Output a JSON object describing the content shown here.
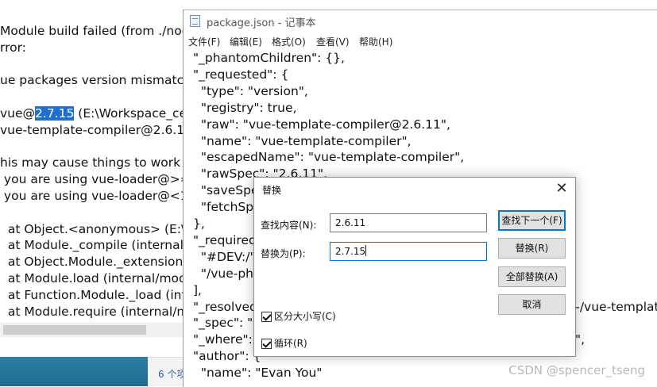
{
  "background_page": {
    "lines": [
      "Module build failed (from ./nod",
      "rror:",
      "",
      "ue packages version mismatch",
      "",
      "vue@|2.7.15| (E:\\Workspace_ce",
      "vue-template-compiler@2.6.1",
      "",
      "his may cause things to work i",
      " you are using vue-loader@>=",
      " you are using vue-loader@<1",
      "",
      "  at Object.<anonymous> (E:\\",
      "  at Module._compile (internal/",
      "  at Object.Module._extensions",
      "  at Module.load (internal/mod",
      "  at Function.Module._load (int",
      "  at Module.require (internal/m"
    ],
    "status_text": "6 个项"
  },
  "notepad": {
    "title": "package.json - 记事本",
    "menu": [
      {
        "label": "文件(F)"
      },
      {
        "label": "编辑(E)"
      },
      {
        "label": "格式(O)"
      },
      {
        "label": "查看(V)"
      },
      {
        "label": "帮助(H)"
      }
    ],
    "text_lines": [
      "\"_phantomChildren\": {},",
      "\"_requested\": {",
      "  \"type\": \"version\",",
      "  \"registry\": true,",
      "  \"raw\": \"vue-template-compiler@2.6.11\",",
      "  \"name\": \"vue-template-compiler\",",
      "  \"escapedName\": \"vue-template-compiler\",",
      "  \"rawSpec\": \"2.6.11\",",
      "  \"saveSpe",
      "  \"fetchSp",
      "},",
      "\"_required",
      "  \"#DEV:/\"",
      "  \"/vue-ph",
      "],",
      "\"_resolved",
      "\"_spec\": \"2",
      "\"_where\":",
      "\"author\": {",
      "  \"name\": \"Evan You\""
    ],
    "right_fragments": [
      {
        "line": 15,
        "text": "/-/vue-templat"
      },
      {
        "line": 17,
        "text": "\","
      }
    ],
    "watermark": "CSDN @spencer_tseng"
  },
  "dialog": {
    "title": "替换",
    "find_label": "查找内容(N):",
    "find_value": "2.6.11",
    "replace_label": "替换为(P):",
    "replace_value": "2.7.15",
    "buttons": {
      "find_next": "查找下一个(F)",
      "replace": "替换(R)",
      "replace_all": "全部替换(A)",
      "cancel": "取消"
    },
    "match_case": {
      "label": "区分大小写(C)",
      "checked": true
    },
    "wrap": {
      "label": "循环(R)",
      "checked": true
    }
  }
}
